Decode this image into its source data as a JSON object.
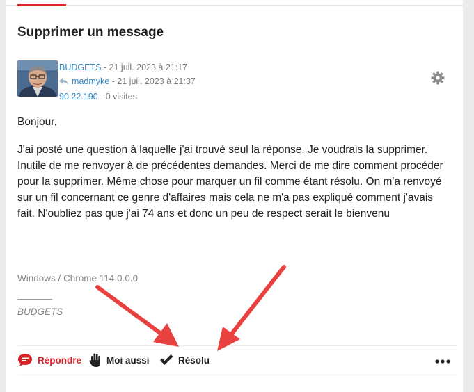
{
  "post": {
    "title": "Supprimer un message",
    "author": "BUDGETS",
    "posted": " - 21 juil. 2023 à 21:17",
    "last_reply_user": "madmyke",
    "last_reply_date": " - 21 juil. 2023 à 21:37",
    "ip": "90.22.190",
    "visits": " - 0 visites",
    "greeting": "Bonjour,",
    "body": "J'ai posté une question à laquelle j'ai trouvé seul la réponse. Je voudrais la supprimer. Inutile de me renvoyer à de précédentes demandes. Merci de me dire comment procéder pour la supprimer. Même chose pour marquer un fil comme étant résolu. On m'a renvoyé sur un fil concernant ce genre d'affaires mais cela ne m'a pas expliqué comment j'avais fait. N'oubliez pas que j'ai 74 ans et donc un peu de respect serait le bienvenu",
    "user_agent": "Windows / Chrome 114.0.0.0",
    "signature": "BUDGETS"
  },
  "actions": {
    "reply": "Répondre",
    "me_too": "Moi aussi",
    "resolved": "Résolu"
  },
  "icons": {
    "settings": "gear-icon",
    "reply": "speech-bubble-icon",
    "me_too": "hand-icon",
    "resolved": "checkmark-icon",
    "more": "more-dots-icon",
    "last_reply": "reply-arrow-icon"
  },
  "colors": {
    "accent": "#d8232a",
    "link": "#2e88c6",
    "annotation_arrow": "#e8413f"
  }
}
